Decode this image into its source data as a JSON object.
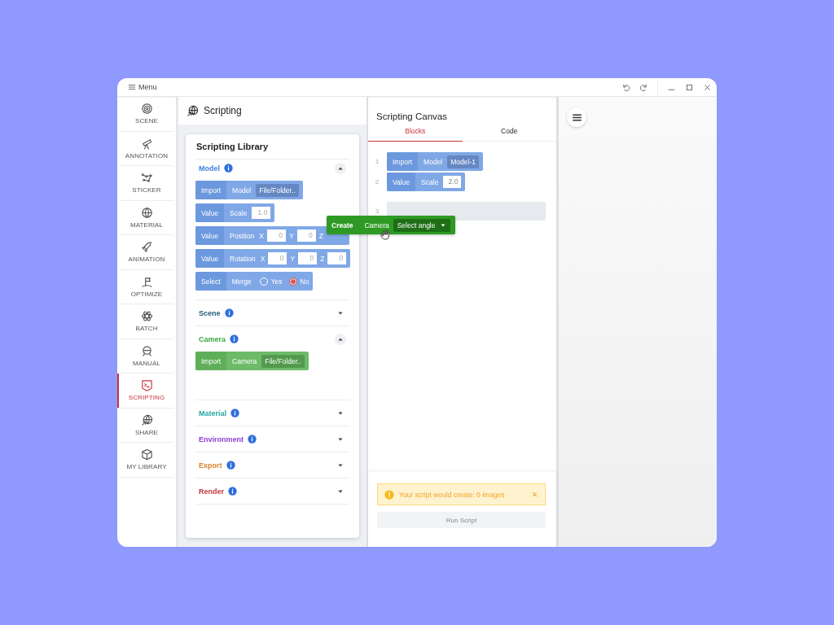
{
  "window": {
    "menu_label": "Menu"
  },
  "sidebar": {
    "items": [
      {
        "label": "SCENE",
        "selected": false
      },
      {
        "label": "ANNOTATION",
        "selected": false
      },
      {
        "label": "STICKER",
        "selected": false
      },
      {
        "label": "MATERIAL",
        "selected": false
      },
      {
        "label": "ANIMATION",
        "selected": false
      },
      {
        "label": "OPTIMIZE",
        "selected": false
      },
      {
        "label": "BATCH",
        "selected": false
      },
      {
        "label": "MANUAL",
        "selected": false
      },
      {
        "label": "SCRIPTING",
        "selected": true
      },
      {
        "label": "SHARE",
        "selected": false
      },
      {
        "label": "MY LIBRARY",
        "selected": false
      }
    ]
  },
  "library": {
    "title": "Scripting",
    "heading": "Scripting Library",
    "sections": [
      {
        "title": "Model",
        "color": "#3d7fd9",
        "expanded": true,
        "blocks": [
          {
            "kind": "import",
            "action": "Import",
            "field": "Model",
            "value": "File/Folder.."
          },
          {
            "kind": "value",
            "action": "Value",
            "field": "Scale",
            "inputs": [
              {
                "value": "1.0"
              }
            ]
          },
          {
            "kind": "value",
            "action": "Value",
            "field": "Position",
            "inputs": [
              {
                "label": "X",
                "value": "0"
              },
              {
                "label": "Y",
                "value": "0"
              },
              {
                "label": "Z"
              }
            ]
          },
          {
            "kind": "value",
            "action": "Value",
            "field": "Rotation",
            "inputs": [
              {
                "label": "X",
                "value": "0"
              },
              {
                "label": "Y",
                "value": "0"
              },
              {
                "label": "Z",
                "value": "0"
              }
            ]
          },
          {
            "kind": "select",
            "action": "Select",
            "field": "Merge",
            "options": [
              {
                "label": "Yes",
                "selected": false
              },
              {
                "label": "No",
                "selected": true
              }
            ]
          }
        ]
      },
      {
        "title": "Scene",
        "color": "#1f5a7a",
        "expanded": false
      },
      {
        "title": "Camera",
        "color": "#3aa83a",
        "expanded": true,
        "blocks": [
          {
            "kind": "import",
            "action": "Import",
            "field": "Camera",
            "value": "File/Folder.."
          }
        ]
      },
      {
        "title": "Material",
        "color": "#25a5a5",
        "expanded": false
      },
      {
        "title": "Environment",
        "color": "#8a3fd0",
        "expanded": false
      },
      {
        "title": "Export",
        "color": "#d9822b",
        "expanded": false
      },
      {
        "title": "Render",
        "color": "#c0393b",
        "expanded": false
      }
    ]
  },
  "canvas": {
    "title": "Scripting Canvas",
    "tabs": [
      {
        "label": "Blocks",
        "selected": true
      },
      {
        "label": "Code",
        "selected": false
      }
    ],
    "lines": [
      {
        "number": "1",
        "block": {
          "kind": "import",
          "action": "Import",
          "field": "Model",
          "value": "Model-1"
        }
      },
      {
        "number": "2",
        "block": {
          "kind": "value",
          "action": "Value",
          "field": "Scale",
          "inputs": [
            {
              "value": "2.0"
            }
          ]
        }
      },
      {
        "number": "3",
        "block": {
          "kind": "slot"
        }
      }
    ],
    "alert": "Your script would create: 0 images",
    "run_button": {
      "label": "Run Script",
      "disabled": true
    }
  },
  "dragged_block": {
    "action": "Create",
    "field": "Camera",
    "dropdown": "Select angle"
  }
}
